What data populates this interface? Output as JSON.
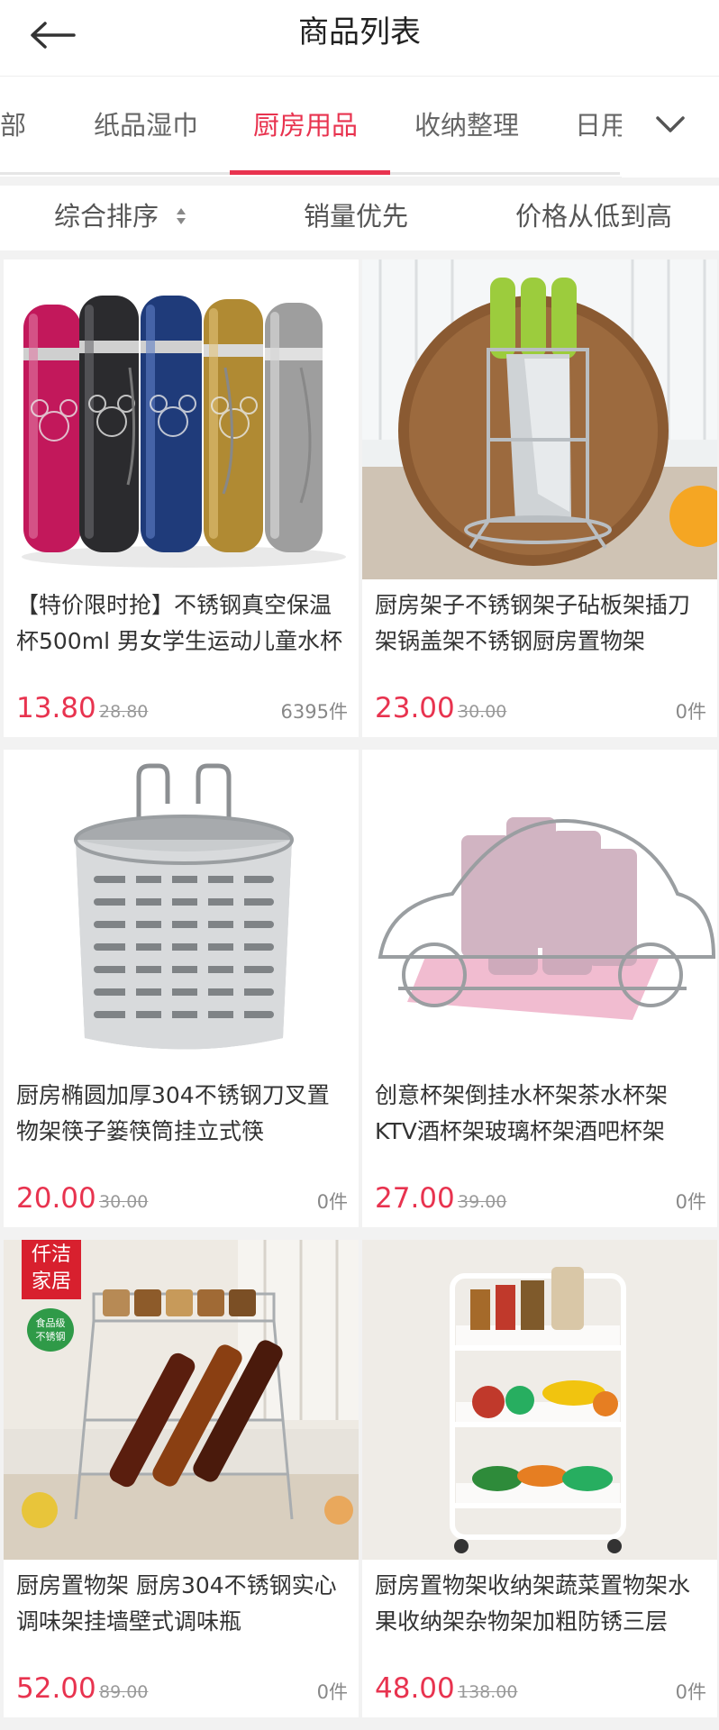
{
  "header": {
    "title": "商品列表"
  },
  "tabs": [
    {
      "label": "部"
    },
    {
      "label": "纸品湿巾"
    },
    {
      "label": "厨房用品"
    },
    {
      "label": "收纳整理"
    },
    {
      "label": "日用"
    }
  ],
  "sort": {
    "comprehensive": "综合排序",
    "sales": "销量优先",
    "price_asc": "价格从低到高"
  },
  "products": [
    {
      "name": "【特价限时抢】不锈钢真空保温杯500ml 男女学生运动儿童水杯",
      "price": "13.80",
      "original_price": "28.80",
      "sold": "6395件"
    },
    {
      "name": "厨房架子不锈钢架子砧板架插刀架锅盖架不锈钢厨房置物架",
      "price": "23.00",
      "original_price": "30.00",
      "sold": "0件"
    },
    {
      "name": "厨房椭圆加厚304不锈钢刀叉置物架筷子篓筷筒挂立式筷",
      "price": "20.00",
      "original_price": "30.00",
      "sold": "0件"
    },
    {
      "name": "创意杯架倒挂水杯架茶水杯架KTV酒杯架玻璃杯架酒吧杯架",
      "price": "27.00",
      "original_price": "39.00",
      "sold": "0件"
    },
    {
      "name": "厨房置物架 厨房304不锈钢实心调味架挂墙壁式调味瓶",
      "price": "52.00",
      "original_price": "89.00",
      "sold": "0件",
      "badge": [
        "仟洁",
        "家居"
      ],
      "sub_badge": [
        "食品级",
        "不锈钢"
      ]
    },
    {
      "name": "厨房置物架收纳架蔬菜置物架水果收纳架杂物架加粗防锈三层",
      "price": "48.00",
      "original_price": "138.00",
      "sold": "0件"
    }
  ],
  "colors": {
    "accent": "#e8334f",
    "text": "#333333",
    "muted": "#999999",
    "background": "#f2f2f2"
  }
}
